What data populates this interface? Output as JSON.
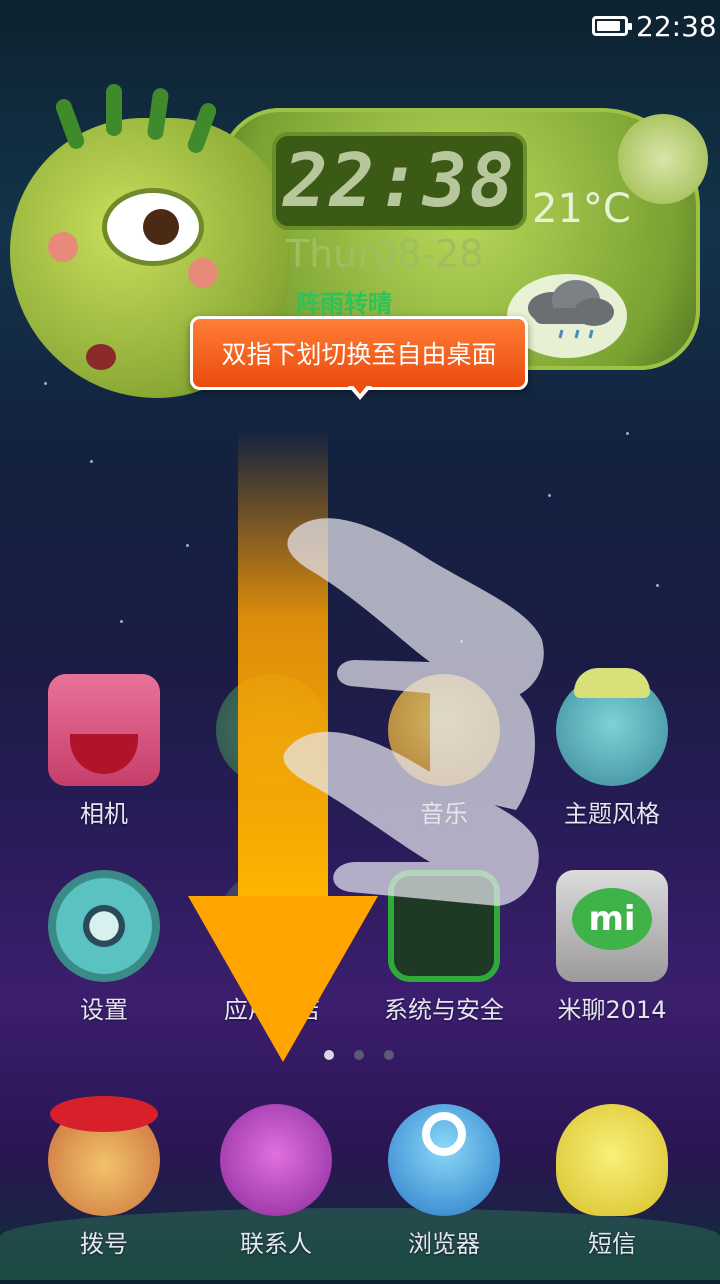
{
  "status_bar": {
    "time": "22:38",
    "battery_level_percent": 90
  },
  "widget": {
    "clock_time": "22:38",
    "temperature": "21°C",
    "date": "Thur08-28",
    "weather": "阵雨转晴",
    "weather_icon": "cloud-rain-icon"
  },
  "tooltip": {
    "text": "双指下划切换至自由桌面"
  },
  "apps": [
    {
      "label": "相机",
      "icon": "camera-monster-icon"
    },
    {
      "label": "",
      "icon": "monster-icon"
    },
    {
      "label": "音乐",
      "icon": "music-monster-icon"
    },
    {
      "label": "主题风格",
      "icon": "theme-monster-icon"
    },
    {
      "label": "设置",
      "icon": "settings-gear-monster-icon"
    },
    {
      "label": "应用商店",
      "icon": "app-store-icon"
    },
    {
      "label": "系统与安全",
      "icon": "security-monster-icon"
    },
    {
      "label": "米聊2014",
      "icon": "miliao-icon"
    }
  ],
  "pager": {
    "pages": 3,
    "active": 1
  },
  "dock": [
    {
      "label": "拨号",
      "icon": "phone-monster-icon"
    },
    {
      "label": "联系人",
      "icon": "contacts-monster-icon"
    },
    {
      "label": "浏览器",
      "icon": "browser-monster-icon"
    },
    {
      "label": "短信",
      "icon": "sms-monster-icon"
    }
  ],
  "gesture": {
    "direction": "down",
    "fingers": 2,
    "arrow_color": "#ffa400"
  }
}
